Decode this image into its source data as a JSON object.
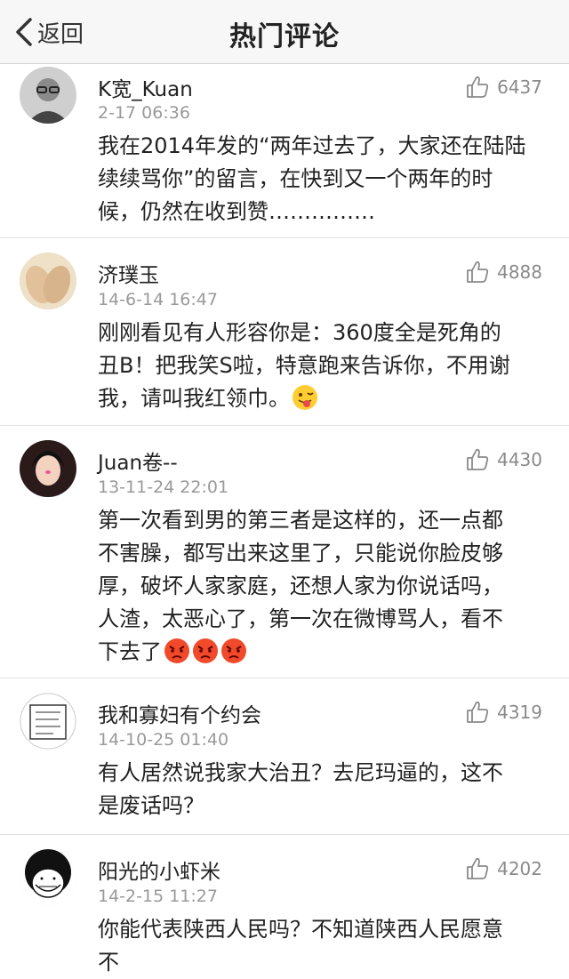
{
  "nav": {
    "back_label": "返回",
    "title": "热门评论"
  },
  "comments": [
    {
      "user": "K宽_Kuan",
      "time": "2-17 06:36",
      "likes": "6437",
      "lines": [
        "我在2014年发的“两年过去了，大家还在陆陆",
        "续续骂你”的留言，在快到又一个两年的时",
        "候，仍然在收到赞……………"
      ]
    },
    {
      "user": "济璞玉",
      "time": "14-6-14 16:47",
      "likes": "4888",
      "lines": [
        "刚刚看见有人形容你是：360度全是死角的",
        "丑B！把我笑S啦，特意跑来告诉你，不用谢",
        "我，请叫我红领巾。"
      ]
    },
    {
      "user": "Juan卷--",
      "time": "13-11-24 22:01",
      "likes": "4430",
      "lines": [
        "第一次看到男的第三者是这样的，还一点都",
        "不害臊，都写出来这里了，只能说你脸皮够",
        "厚，破坏人家家庭，还想人家为你说话吗，",
        "人渣，太恶心了，第一次在微博骂人，看不",
        "下去了"
      ]
    },
    {
      "user": "我和寡妇有个约会",
      "time": "14-10-25 01:40",
      "likes": "4319",
      "lines": [
        "有人居然说我家大治丑？去尼玛逼的，这不",
        "是废话吗？"
      ]
    },
    {
      "user": "阳光的小虾米",
      "time": "14-2-15 11:27",
      "likes": "4202",
      "lines": [
        "你能代表陕西人民吗？不知道陕西人民愿意",
        "不"
      ]
    }
  ],
  "icons": {
    "back": "chevron-left-icon",
    "like": "thumbs-up-icon",
    "emoji_tongue": "tongue-out-emoji",
    "emoji_angry": "angry-emoji"
  },
  "colors": {
    "nav_bg": "#f7f7f7",
    "muted": "#9a9a9a",
    "text": "#222222"
  }
}
